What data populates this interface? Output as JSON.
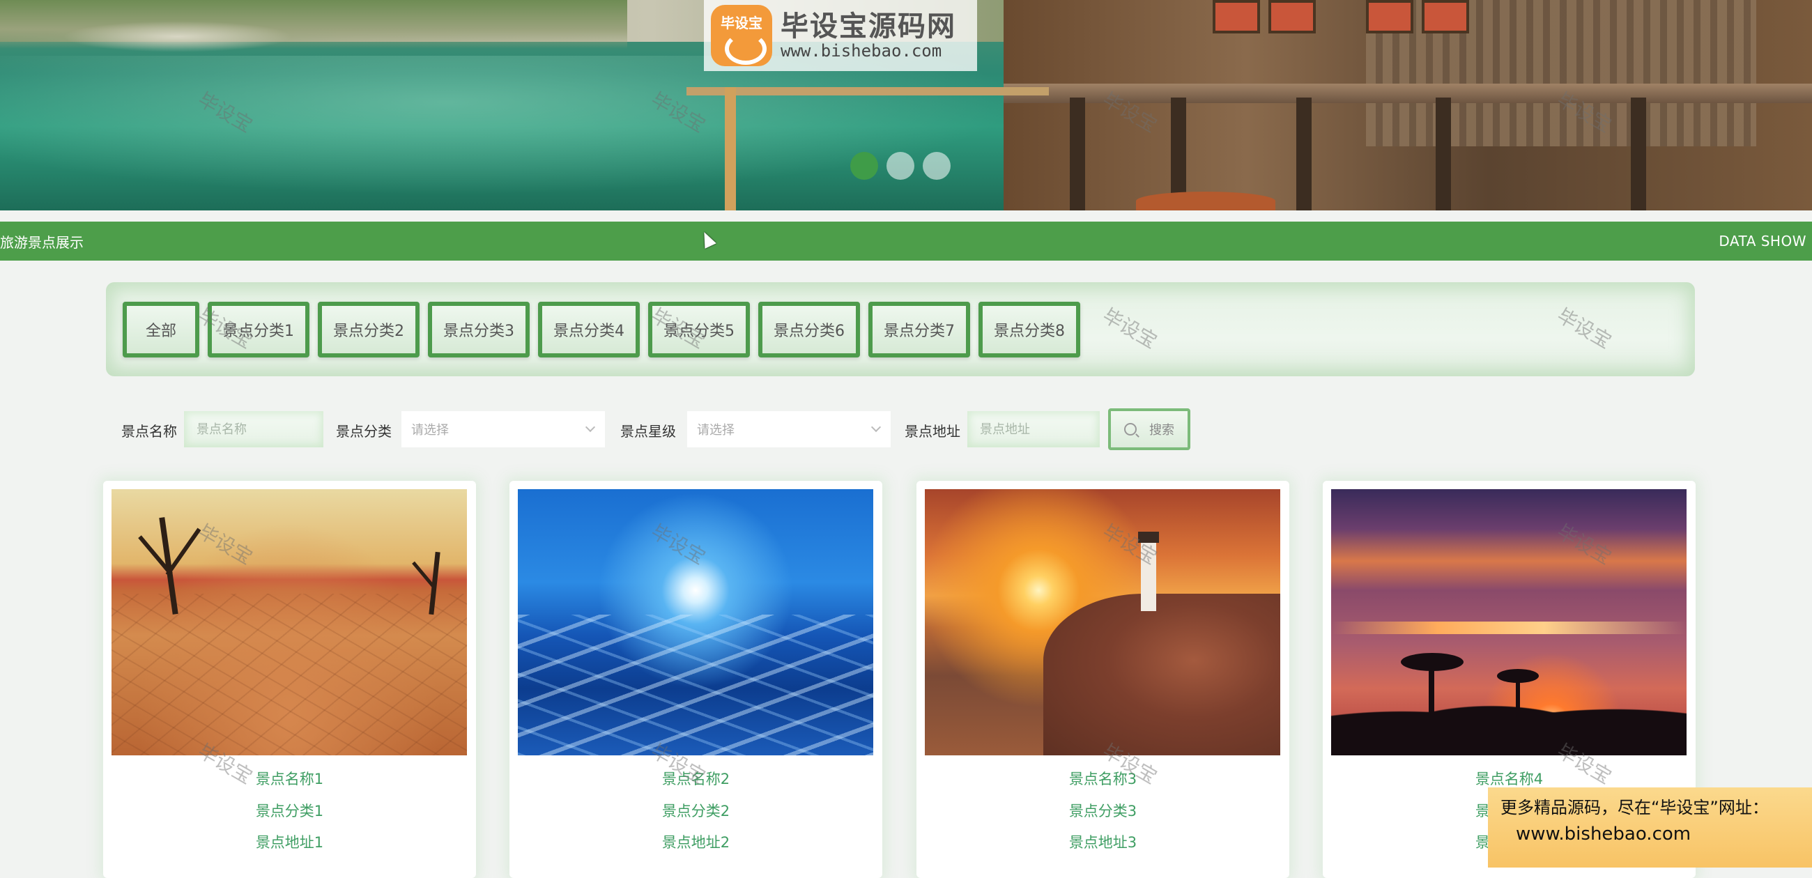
{
  "banner": {
    "watermark_title": "毕设宝源码网",
    "watermark_url": "www.bishebao.com",
    "logo_badge": "毕设宝",
    "slides": 3,
    "active_slide": 1
  },
  "section": {
    "title": "旅游景点展示",
    "subtitle": "DATA SHOW"
  },
  "categories": [
    "全部",
    "景点分类1",
    "景点分类2",
    "景点分类3",
    "景点分类4",
    "景点分类5",
    "景点分类6",
    "景点分类7",
    "景点分类8"
  ],
  "filters": {
    "name_label": "景点名称",
    "name_placeholder": "景点名称",
    "category_label": "景点分类",
    "category_value": "请选择",
    "level_label": "景点星级",
    "level_value": "请选择",
    "address_label": "景点地址",
    "address_placeholder": "景点地址",
    "search_label": "搜索"
  },
  "cards": [
    {
      "name": "景点名称1",
      "category": "景点分类1",
      "address": "景点地址1"
    },
    {
      "name": "景点名称2",
      "category": "景点分类2",
      "address": "景点地址2"
    },
    {
      "name": "景点名称3",
      "category": "景点分类3",
      "address": "景点地址3"
    },
    {
      "name": "景点名称4",
      "category": "景点分类4",
      "address": "景点地址4"
    }
  ],
  "overlay": {
    "watermark_text": "毕设宝",
    "promo_line1": "更多精品源码，尽在“毕设宝”网址：",
    "promo_line2": "www.bishebao.com"
  },
  "colors": {
    "accent_green": "#4d9e4a",
    "text_green": "#3f9e63",
    "promo_bg": "#f8c365"
  }
}
